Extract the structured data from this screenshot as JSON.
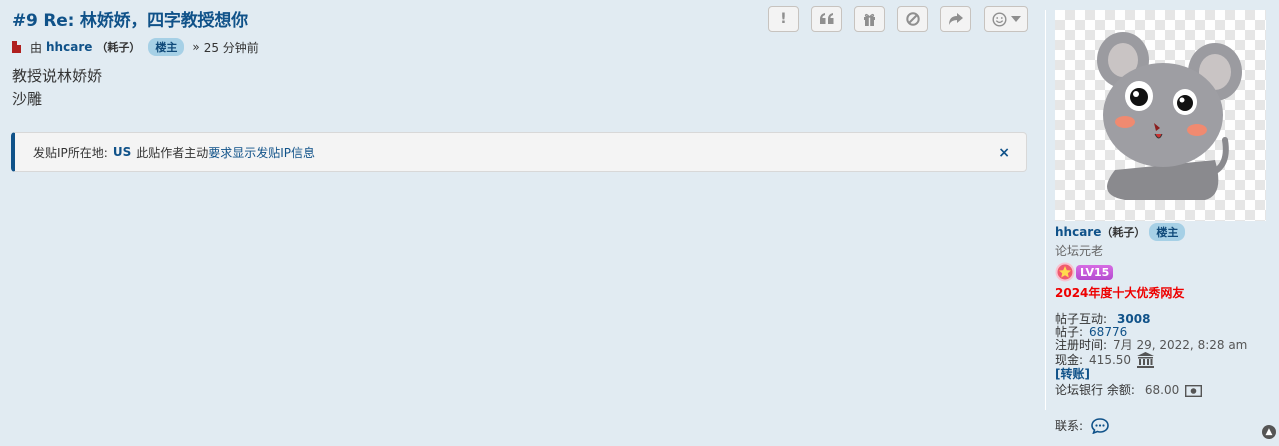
{
  "post": {
    "title": "#9 Re: 林娇娇，四字教授想你",
    "by_label": "由",
    "author": "hhcare",
    "author_alias": "（耗子）",
    "op_badge": "楼主",
    "time_sep": "»",
    "time": "25 分钟前",
    "content_lines": [
      "教授说林娇娇",
      "沙雕"
    ]
  },
  "toolbar": {
    "buttons": [
      {
        "name": "report-button",
        "icon": "exclamation-icon"
      },
      {
        "name": "quote-button",
        "icon": "quote-icon"
      },
      {
        "name": "gift-button",
        "icon": "gift-icon"
      },
      {
        "name": "block-button",
        "icon": "ban-icon"
      },
      {
        "name": "share-button",
        "icon": "share-icon"
      },
      {
        "name": "reaction-button",
        "icon": "smile-icon"
      }
    ]
  },
  "ip_notice": {
    "prefix": "发贴IP所在地:",
    "country": "US",
    "middle": "此贴作者主动",
    "link": "要求显示发贴IP信息",
    "close": "×"
  },
  "profile": {
    "username": "hhcare",
    "alias": "（耗子）",
    "op_badge": "楼主",
    "rank": "论坛元老",
    "level": "LV15",
    "award": "2024年度十大优秀网友",
    "stats": {
      "interactions_label": "帖子互动:",
      "interactions": "3008",
      "posts_label": "帖子:",
      "posts": "68776",
      "joined_label": "注册时间:",
      "joined": "7月 29, 2022, 8:28 am",
      "cash_label": "现金:",
      "cash": "415.50",
      "transfer": "[转账]",
      "bank_label": "论坛银行 余额:",
      "bank": "68.00"
    },
    "contact_label": "联系:"
  },
  "colors": {
    "background": "#e1ebf2",
    "link": "#105289",
    "award": "#e00000",
    "badge_bg": "#a6d0e6"
  }
}
